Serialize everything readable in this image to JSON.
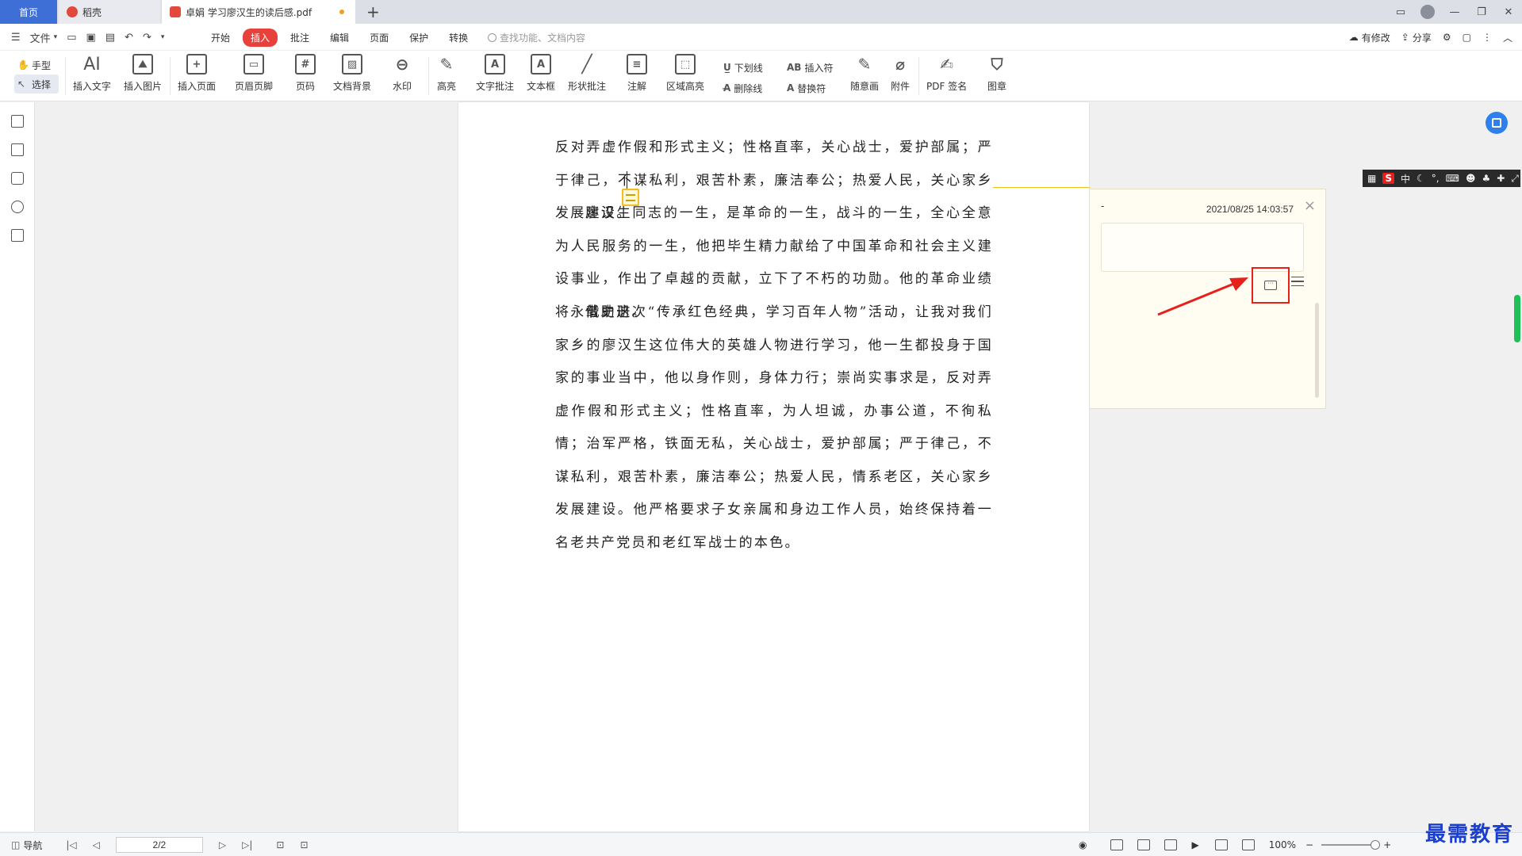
{
  "tabs": {
    "home": "首页",
    "daoke": "稻壳",
    "doc": "卓娟 学习廖汉生的读后感.pdf",
    "new_tab": "+"
  },
  "menu": {
    "file": "文件",
    "tabs": [
      "开始",
      "插入",
      "批注",
      "编辑",
      "页面",
      "保护",
      "转换"
    ],
    "active_tab": "插入",
    "search_placeholder": "查找功能、文档内容",
    "modified": "有修改",
    "share": "分享"
  },
  "toolbar": {
    "hand": "手型",
    "select": "选择",
    "insert_text": "插入文字",
    "insert_image": "插入图片",
    "insert_page": "插入页面",
    "header_footer": "页眉页脚",
    "page_number": "页码",
    "doc_background": "文档背景",
    "watermark": "水印",
    "highlight": "高亮",
    "text_comment": "文字批注",
    "text_box": "文本框",
    "shape_comment": "形状批注",
    "note": "注解",
    "area_highlight": "区域高亮",
    "underline": "下划线",
    "strikethrough": "删除线",
    "insert_symbol": "插入符",
    "replace_symbol": "替换符",
    "freehand": "随意画",
    "attachment": "附件",
    "pdf_sign": "PDF 签名",
    "stamp": "图章"
  },
  "document": {
    "paragraphs": [
      "反对弄虚作假和形式主义；性格直率，关心战士，爱护部属；严于律己，不谋私利，艰苦朴素，廉洁奉公；热爱人民，关心家乡发展建设。",
      "廖汉生同志的一生，是革命的一生，战斗的一生，全心全意为人民服务的一生，他把毕生精力献给了中国革命和社会主义建设事业，作出了卓越的贡献，立下了不朽的功勋。他的革命业绩将永载史册。",
      "借助这次“传承红色经典，学习百年人物”活动，让我对我们家乡的廖汉生这位伟大的英雄人物进行学习，他一生都投身于国家的事业当中，他以身作则，身体力行；崇尚实事求是，反对弄虚作假和形式主义；性格直率，为人坦诚，办事公道，不徇私情；治军严格，铁面无私，关心战士，爱护部属；严于律己，不谋私利，艰苦朴素，廉洁奉公；热爱人民，情系老区，关心家乡发展建设。他严格要求子女亲属和身边工作人员，始终保持着一名老共产党员和老红军战士的本色。"
    ]
  },
  "comment": {
    "author": "-",
    "timestamp": "2021/08/25 14:03:57",
    "close": "×"
  },
  "ime": {
    "logo": "S",
    "lang": "中"
  },
  "status": {
    "nav": "导航",
    "page": "2/2",
    "zoom": "100%",
    "minus": "−",
    "plus": "+"
  },
  "watermark_text": "最需教育",
  "colors": {
    "accent_blue": "#3e6fd7",
    "active_tab_red": "#e8413c",
    "highlight_box": "#e8201c",
    "comment_yellow": "#f0c020"
  }
}
